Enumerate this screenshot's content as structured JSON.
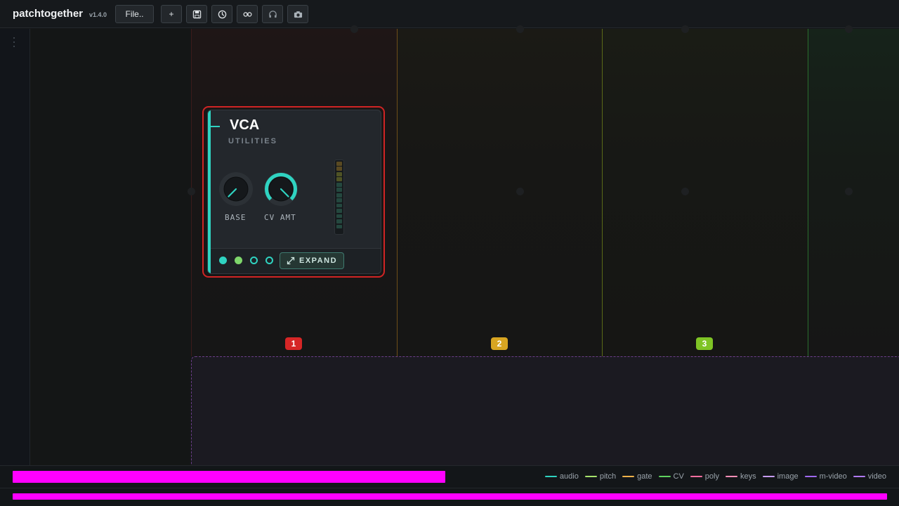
{
  "app": {
    "name": "patchtogether",
    "version": "v1.4.0"
  },
  "toolbar": {
    "file_label": "File..",
    "add_label": "+",
    "buttons": [
      "save-icon",
      "clock-icon",
      "link-icon",
      "headphones-icon",
      "camera-icon"
    ]
  },
  "columns": [
    {
      "number": "1",
      "color": "#d62626"
    },
    {
      "number": "2",
      "color": "#d8a521"
    },
    {
      "number": "3",
      "color": "#7fc425"
    }
  ],
  "module": {
    "title": "VCA",
    "category": "UTILITIES",
    "knobs": [
      {
        "label": "BASE",
        "value": 0.0
      },
      {
        "label": "CV AMT",
        "value": 1.0
      }
    ],
    "expand_label": "EXPAND",
    "accent_color": "#2fd3c1"
  },
  "progress": {
    "primary": 0.49,
    "secondary": 1.0
  },
  "legend": [
    {
      "label": "audio",
      "color": "#2fd3c1"
    },
    {
      "label": "pitch",
      "color": "#a6e36c"
    },
    {
      "label": "gate",
      "color": "#f0b24a"
    },
    {
      "label": "CV",
      "color": "#5fd35f"
    },
    {
      "label": "poly",
      "color": "#ff6fa0"
    },
    {
      "label": "keys",
      "color": "#ff8fb8"
    },
    {
      "label": "image",
      "color": "#c79cf5"
    },
    {
      "label": "m-video",
      "color": "#a06af0"
    },
    {
      "label": "video",
      "color": "#b07af5"
    }
  ]
}
